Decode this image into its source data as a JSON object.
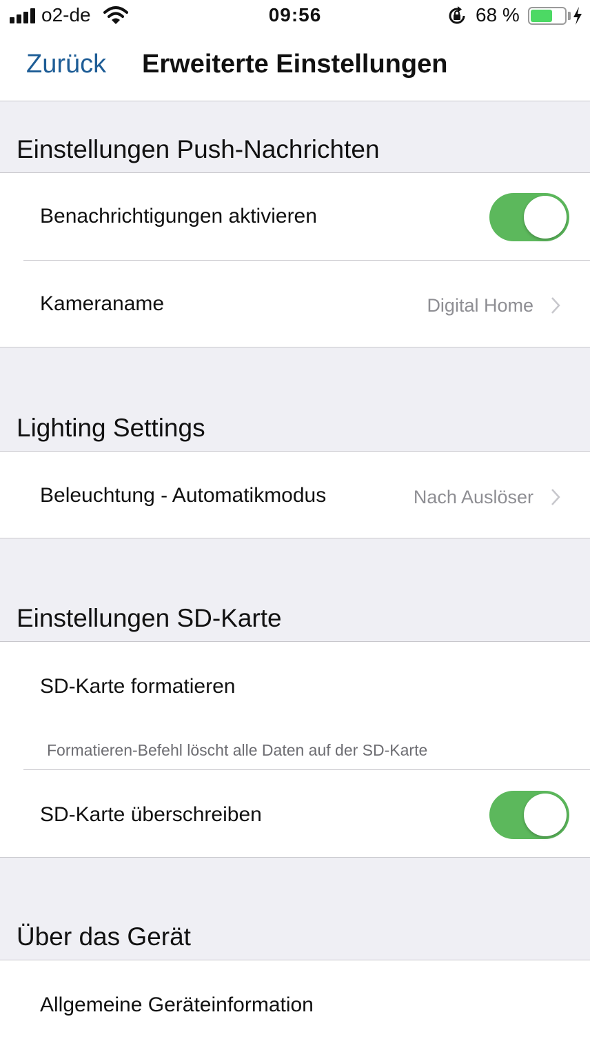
{
  "status_bar": {
    "carrier": "o2-de",
    "time": "09:56",
    "battery_percent": "68 %",
    "battery_level": 0.68,
    "icons": [
      "signal-icon",
      "wifi-icon",
      "rotation-lock-icon",
      "battery-icon",
      "charging-icon"
    ]
  },
  "nav": {
    "back_label": "Zurück",
    "title": "Erweiterte Einstellungen"
  },
  "colors": {
    "accent": "#1e5d96",
    "toggle_on": "#5cb85c",
    "background": "#efeff4",
    "secondary_text": "#8e8e93"
  },
  "sections": {
    "push": {
      "header": "Einstellungen Push-Nachrichten",
      "notifications_label": "Benachrichtigungen aktivieren",
      "notifications_on": true,
      "camera_name_label": "Kameraname",
      "camera_name_value": "Digital Home"
    },
    "lighting": {
      "header": "Lighting Settings",
      "auto_mode_label": "Beleuchtung - Automatikmodus",
      "auto_mode_value": "Nach Auslöser"
    },
    "sd": {
      "header": "Einstellungen SD-Karte",
      "format_label": "SD-Karte formatieren",
      "format_note": "Formatieren-Befehl löscht alle Daten auf der SD-Karte",
      "overwrite_label": "SD-Karte überschreiben",
      "overwrite_on": true
    },
    "device": {
      "header": "Über das Gerät",
      "general_info_label": "Allgemeine Geräteinformation"
    }
  }
}
